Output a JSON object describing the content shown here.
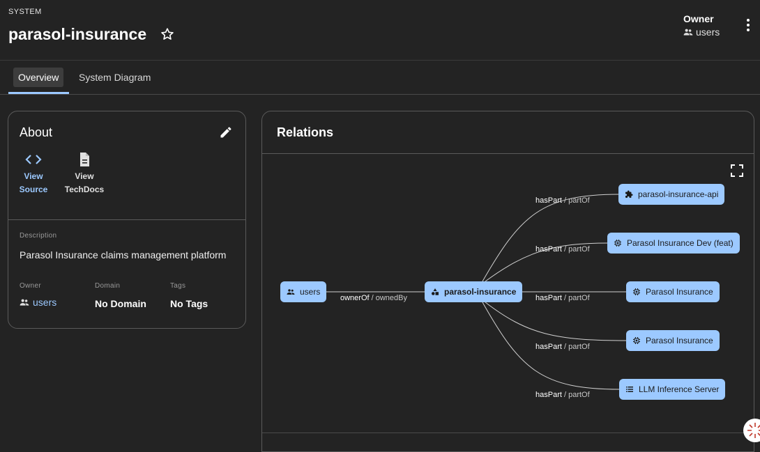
{
  "header": {
    "kind": "SYSTEM",
    "title": "parasol-insurance",
    "owner_label": "Owner",
    "owner_value": "users"
  },
  "tabs": [
    {
      "label": "Overview",
      "active": true
    },
    {
      "label": "System Diagram",
      "active": false
    }
  ],
  "about": {
    "title": "About",
    "links": [
      {
        "line1": "View",
        "line2": "Source",
        "icon": "code-icon"
      },
      {
        "line1": "View",
        "line2": "TechDocs",
        "icon": "document-icon"
      }
    ],
    "description_label": "Description",
    "description": "Parasol Insurance claims management platform",
    "owner_label": "Owner",
    "owner_value": "users",
    "domain_label": "Domain",
    "domain_value": "No Domain",
    "tags_label": "Tags",
    "tags_value": "No Tags"
  },
  "relations": {
    "title": "Relations",
    "nodes": {
      "users": "users",
      "center": "parasol-insurance",
      "api": "parasol-insurance-api",
      "dev": "Parasol Insurance Dev (feat)",
      "prod1": "Parasol Insurance",
      "prod2": "Parasol Insurance",
      "llm": "LLM Inference Server"
    },
    "edges": {
      "owner_rel": "ownerOf",
      "owner_inv": " / ownedBy",
      "part_rel": "hasPart",
      "part_inv": " / partOf"
    }
  },
  "colors": {
    "accent": "#9cc9ff",
    "background": "#232323",
    "node_fill": "#9cc9ff"
  }
}
